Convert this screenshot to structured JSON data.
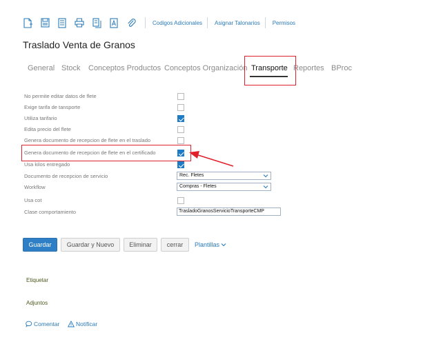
{
  "toolbar": {
    "icons": [
      "new-document-icon",
      "save-icon",
      "list-icon",
      "print-icon",
      "copy-document-icon",
      "text-document-icon",
      "attach-icon"
    ],
    "links": [
      "Codigos Adicionales",
      "Asignar Talonarios",
      "Permisos"
    ]
  },
  "page": {
    "title": "Traslado Venta de Granos"
  },
  "tabs": [
    {
      "label": "General",
      "active": false
    },
    {
      "label": "Stock",
      "active": false
    },
    {
      "label": "Conceptos Productos",
      "active": false
    },
    {
      "label": "Conceptos Organización",
      "active": false
    },
    {
      "label": "Transporte",
      "active": true
    },
    {
      "label": "Reportes",
      "active": false
    },
    {
      "label": "BProc",
      "active": false
    }
  ],
  "form": [
    {
      "label": "No permite editar datos de flete",
      "type": "checkbox",
      "checked": false
    },
    {
      "label": "Exige tarifa de tansporte",
      "type": "checkbox",
      "checked": false
    },
    {
      "label": "Utiliza tarifario",
      "type": "checkbox",
      "checked": true
    },
    {
      "label": "Edita precio del flete",
      "type": "checkbox",
      "checked": false
    },
    {
      "label": "Genera documento de recepcion de flete en el traslado",
      "type": "checkbox",
      "checked": false
    },
    {
      "label": "Genera documento de recepcion de flete en el certificado",
      "type": "checkbox",
      "checked": true
    },
    {
      "label": "Usa kilos entregado",
      "type": "checkbox",
      "checked": true
    },
    {
      "label": "Documento de recepcion de servicio",
      "type": "select",
      "value": "Rec. Fletes"
    },
    {
      "label": "Workflow",
      "type": "select",
      "value": "Compras - Fletes"
    },
    {
      "label": "Usa cot",
      "type": "checkbox",
      "checked": false
    },
    {
      "label": "Clase comportamiento",
      "type": "text",
      "value": "TrasladoGranosServicioTransporteCMP"
    }
  ],
  "actions": {
    "save": "Guardar",
    "save_new": "Guardar y Nuevo",
    "delete": "Eliminar",
    "close": "cerrar",
    "templates": "Plantillas"
  },
  "sections": {
    "tags": "Etiquetar",
    "attachments": "Adjuntos"
  },
  "footer": {
    "comment": "Comentar",
    "notify": "Notificar"
  },
  "colors": {
    "accent": "#2f7fc7",
    "highlight": "#e0202a",
    "section_label": "#4a5a1e"
  }
}
